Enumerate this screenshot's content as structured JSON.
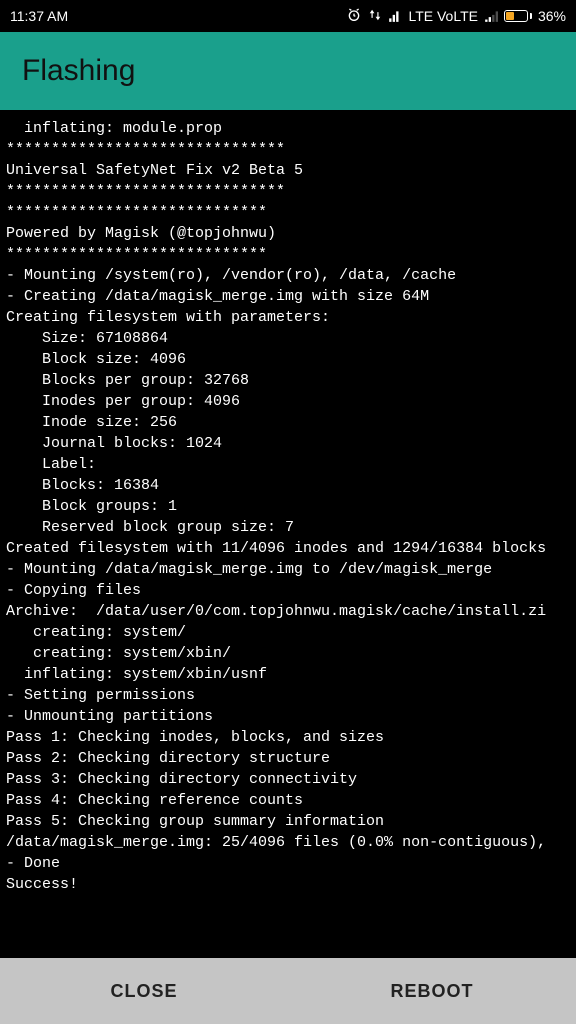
{
  "status_bar": {
    "time": "11:37 AM",
    "network_label": "LTE VoLTE",
    "battery_percent": "36%"
  },
  "app_bar": {
    "title": "Flashing"
  },
  "terminal_lines": [
    "  inflating: module.prop",
    "*******************************",
    "Universal SafetyNet Fix v2 Beta 5",
    "*******************************",
    "*****************************",
    "Powered by Magisk (@topjohnwu)",
    "*****************************",
    "- Mounting /system(ro), /vendor(ro), /data, /cache",
    "- Creating /data/magisk_merge.img with size 64M",
    "Creating filesystem with parameters:",
    "    Size: 67108864",
    "    Block size: 4096",
    "    Blocks per group: 32768",
    "    Inodes per group: 4096",
    "    Inode size: 256",
    "    Journal blocks: 1024",
    "    Label:",
    "    Blocks: 16384",
    "    Block groups: 1",
    "    Reserved block group size: 7",
    "Created filesystem with 11/4096 inodes and 1294/16384 blocks",
    "- Mounting /data/magisk_merge.img to /dev/magisk_merge",
    "- Copying files",
    "Archive:  /data/user/0/com.topjohnwu.magisk/cache/install.zi",
    "   creating: system/",
    "   creating: system/xbin/",
    "  inflating: system/xbin/usnf",
    "- Setting permissions",
    "- Unmounting partitions",
    "Pass 1: Checking inodes, blocks, and sizes",
    "Pass 2: Checking directory structure",
    "Pass 3: Checking directory connectivity",
    "Pass 4: Checking reference counts",
    "Pass 5: Checking group summary information",
    "/data/magisk_merge.img: 25/4096 files (0.0% non-contiguous),",
    "- Done",
    "Success!"
  ],
  "buttons": {
    "close_label": "CLOSE",
    "reboot_label": "REBOOT"
  }
}
